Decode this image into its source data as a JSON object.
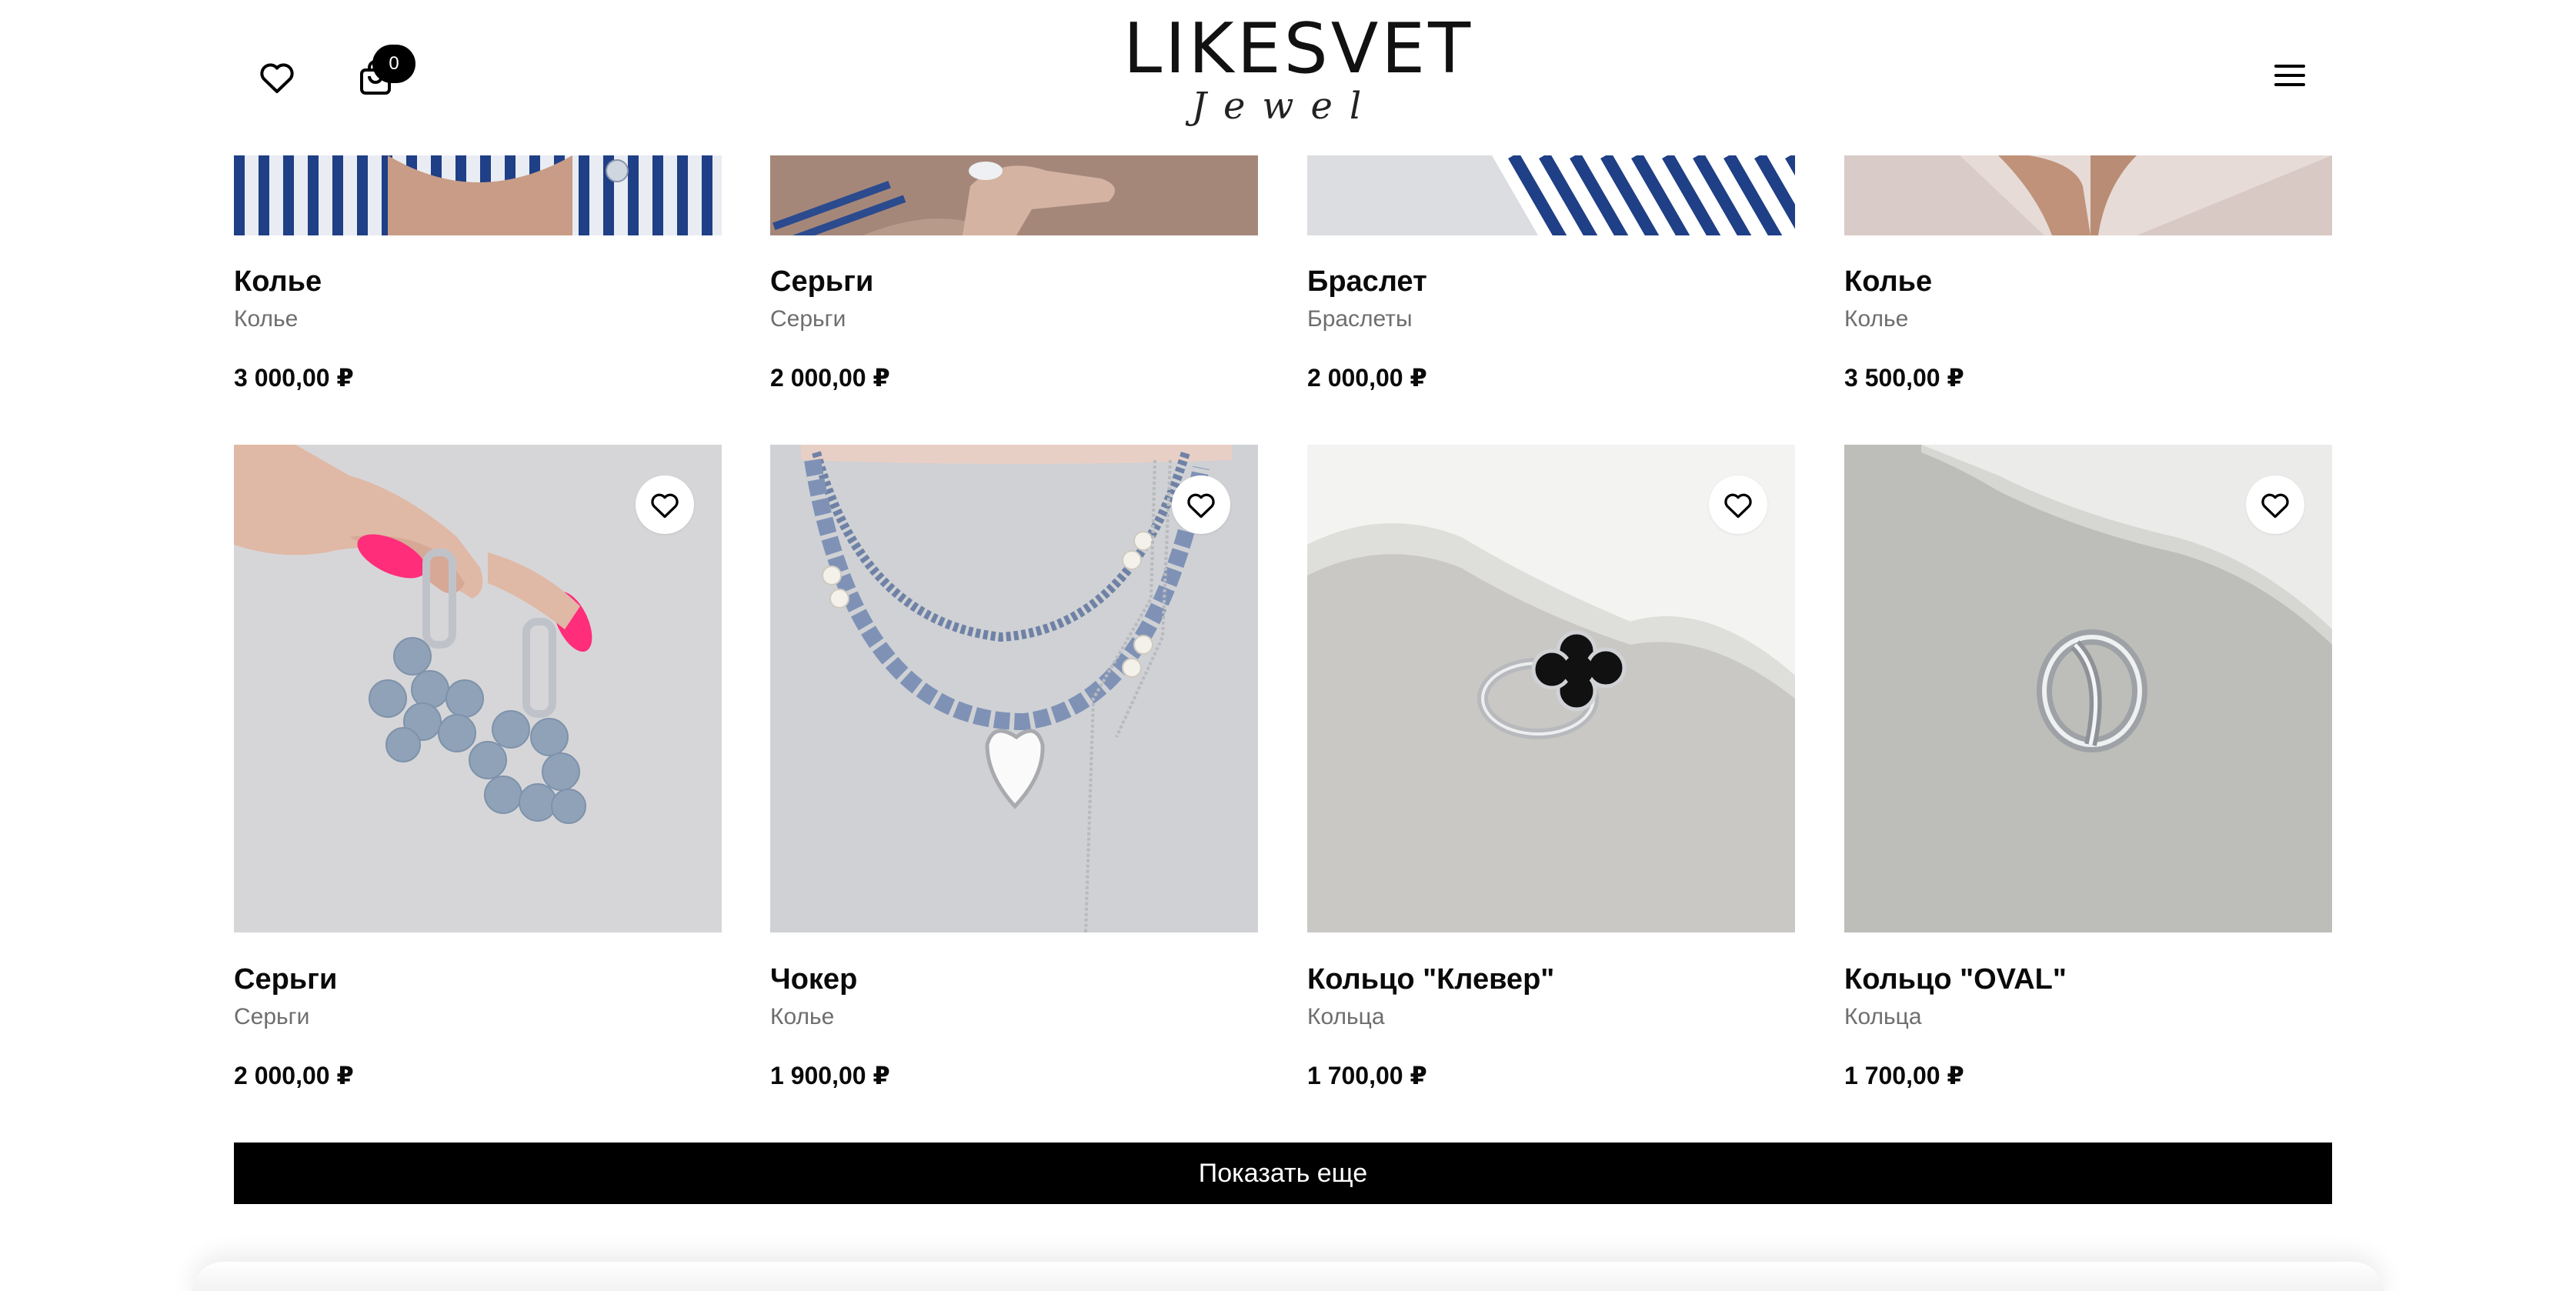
{
  "header": {
    "logo_main": "LIKESVET",
    "logo_sub": "Jewel",
    "cart_count": "0",
    "icons": {
      "favorites": "heart-icon",
      "cart": "shopping-bag-icon",
      "menu": "hamburger-menu-icon"
    }
  },
  "products": [
    {
      "title": "Колье",
      "category": "Колье",
      "price": "3 000,00 ₽"
    },
    {
      "title": "Серьги",
      "category": "Серьги",
      "price": "2 000,00 ₽"
    },
    {
      "title": "Браслет",
      "category": "Браслеты",
      "price": "2 000,00 ₽"
    },
    {
      "title": "Колье",
      "category": "Колье",
      "price": "3 500,00 ₽"
    },
    {
      "title": "Серьги",
      "category": "Серьги",
      "price": "2 000,00 ₽"
    },
    {
      "title": "Чокер",
      "category": "Колье",
      "price": "1 900,00 ₽"
    },
    {
      "title": "Кольцо \"Клевер\"",
      "category": "Кольца",
      "price": "1 700,00 ₽"
    },
    {
      "title": "Кольцо \"OVAL\"",
      "category": "Кольца",
      "price": "1 700,00 ₽"
    }
  ],
  "show_more_label": "Показать еще",
  "colors": {
    "accent": "#000000",
    "muted_text": "#6e6e6e",
    "background": "#ffffff"
  }
}
